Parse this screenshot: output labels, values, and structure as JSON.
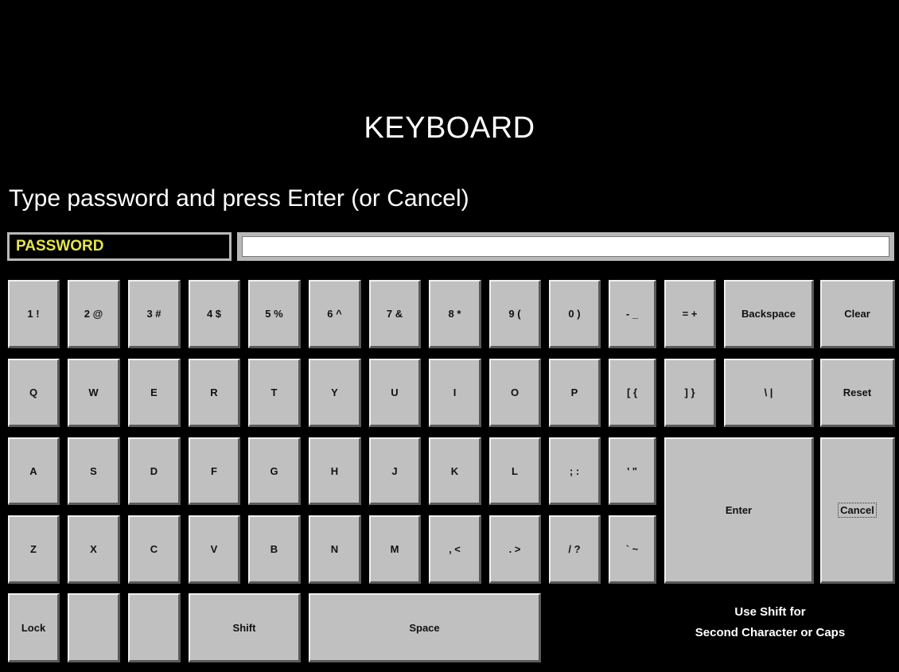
{
  "title": "KEYBOARD",
  "prompt": "Type password and press Enter (or Cancel)",
  "field": {
    "label": "PASSWORD",
    "value": ""
  },
  "keys": {
    "k1": "1 !",
    "k2": "2 @",
    "k3": "3 #",
    "k4": "4 $",
    "k5": "5 %",
    "k6": "6 ^",
    "k7": "7 &",
    "k8": "8 *",
    "k9": "9 (",
    "k0": "0 )",
    "minus": "- _",
    "equals": "= +",
    "backspace": "Backspace",
    "clear": "Clear",
    "q": "Q",
    "w": "W",
    "e": "E",
    "r": "R",
    "t": "T",
    "y": "Y",
    "u": "U",
    "i": "I",
    "o": "O",
    "p": "P",
    "lbracket": "[ {",
    "rbracket": "] }",
    "backslash": "\\ |",
    "reset": "Reset",
    "a": "A",
    "s": "S",
    "d": "D",
    "f": "F",
    "g": "G",
    "h": "H",
    "j": "J",
    "k": "K",
    "l": "L",
    "semicolon": "; :",
    "quote": "' \"",
    "enter": "Enter",
    "cancel": "Cancel",
    "z": "Z",
    "x": "X",
    "c": "C",
    "v": "V",
    "b": "B",
    "n": "N",
    "m": "M",
    "comma": ", <",
    "period": ". >",
    "slash": "/ ?",
    "backtick": "` ~",
    "lock": "Lock",
    "blank1": "",
    "blank2": "",
    "shift": "Shift",
    "space": "Space"
  },
  "note": {
    "line1": "Use Shift for",
    "line2": "Second Character or Caps"
  }
}
